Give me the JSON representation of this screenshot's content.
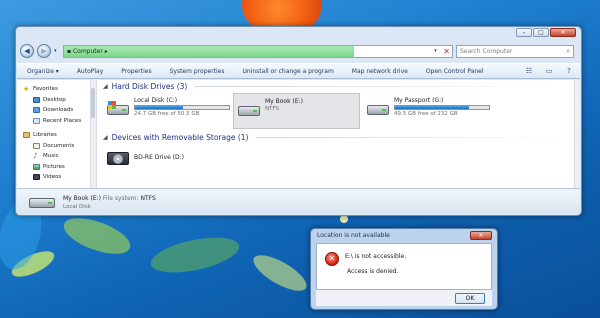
{
  "explorer": {
    "caption_buttons": {
      "minimize": "–",
      "maximize": "□",
      "close": "✕"
    },
    "address": {
      "back": "◀",
      "forward": "▶",
      "path": "▪ Computer ▸",
      "refresh_glyph": "✕"
    },
    "search": {
      "placeholder": "Search Computer"
    },
    "toolbar": {
      "items": [
        "Organize ▾",
        "AutoPlay",
        "Properties",
        "System properties",
        "Uninstall or change a program",
        "Map network drive",
        "Open Control Panel"
      ]
    },
    "nav": {
      "favorites": "Favorites",
      "desktop": "Desktop",
      "downloads": "Downloads",
      "recent": "Recent Places",
      "libraries": "Libraries",
      "documents": "Documents",
      "music": "Music",
      "pictures": "Pictures",
      "videos": "Videos"
    },
    "groups": {
      "hdd_title": "Hard Disk Drives (3)",
      "removable_title": "Devices with Removable Storage (1)"
    },
    "drives": [
      {
        "name": "Local Disk (C:)",
        "subtitle": "24.7 GB free of 50.5 GB",
        "used_fraction": 0.51
      },
      {
        "name": "My Book (E:)",
        "subtitle": "NTFS"
      },
      {
        "name": "My Passport (G:)",
        "subtitle": "49.5 GB free of 232 GB",
        "used_fraction": 0.79
      }
    ],
    "removable": [
      {
        "name": "BD-RE Drive (D:)"
      }
    ],
    "details": {
      "name": "My Book (E:)",
      "fs_label": "File system:",
      "fs_value": "NTFS",
      "type": "Local Disk"
    }
  },
  "dialog": {
    "title": "Location is not available",
    "close": "✕",
    "message": "E:\\ is not accessible.",
    "detail": "Access is denied.",
    "ok": "OK"
  },
  "colors": {
    "drive_bar": "#1e6fc0",
    "address_fill": "#7ed48a",
    "error": "#d51f0e"
  }
}
